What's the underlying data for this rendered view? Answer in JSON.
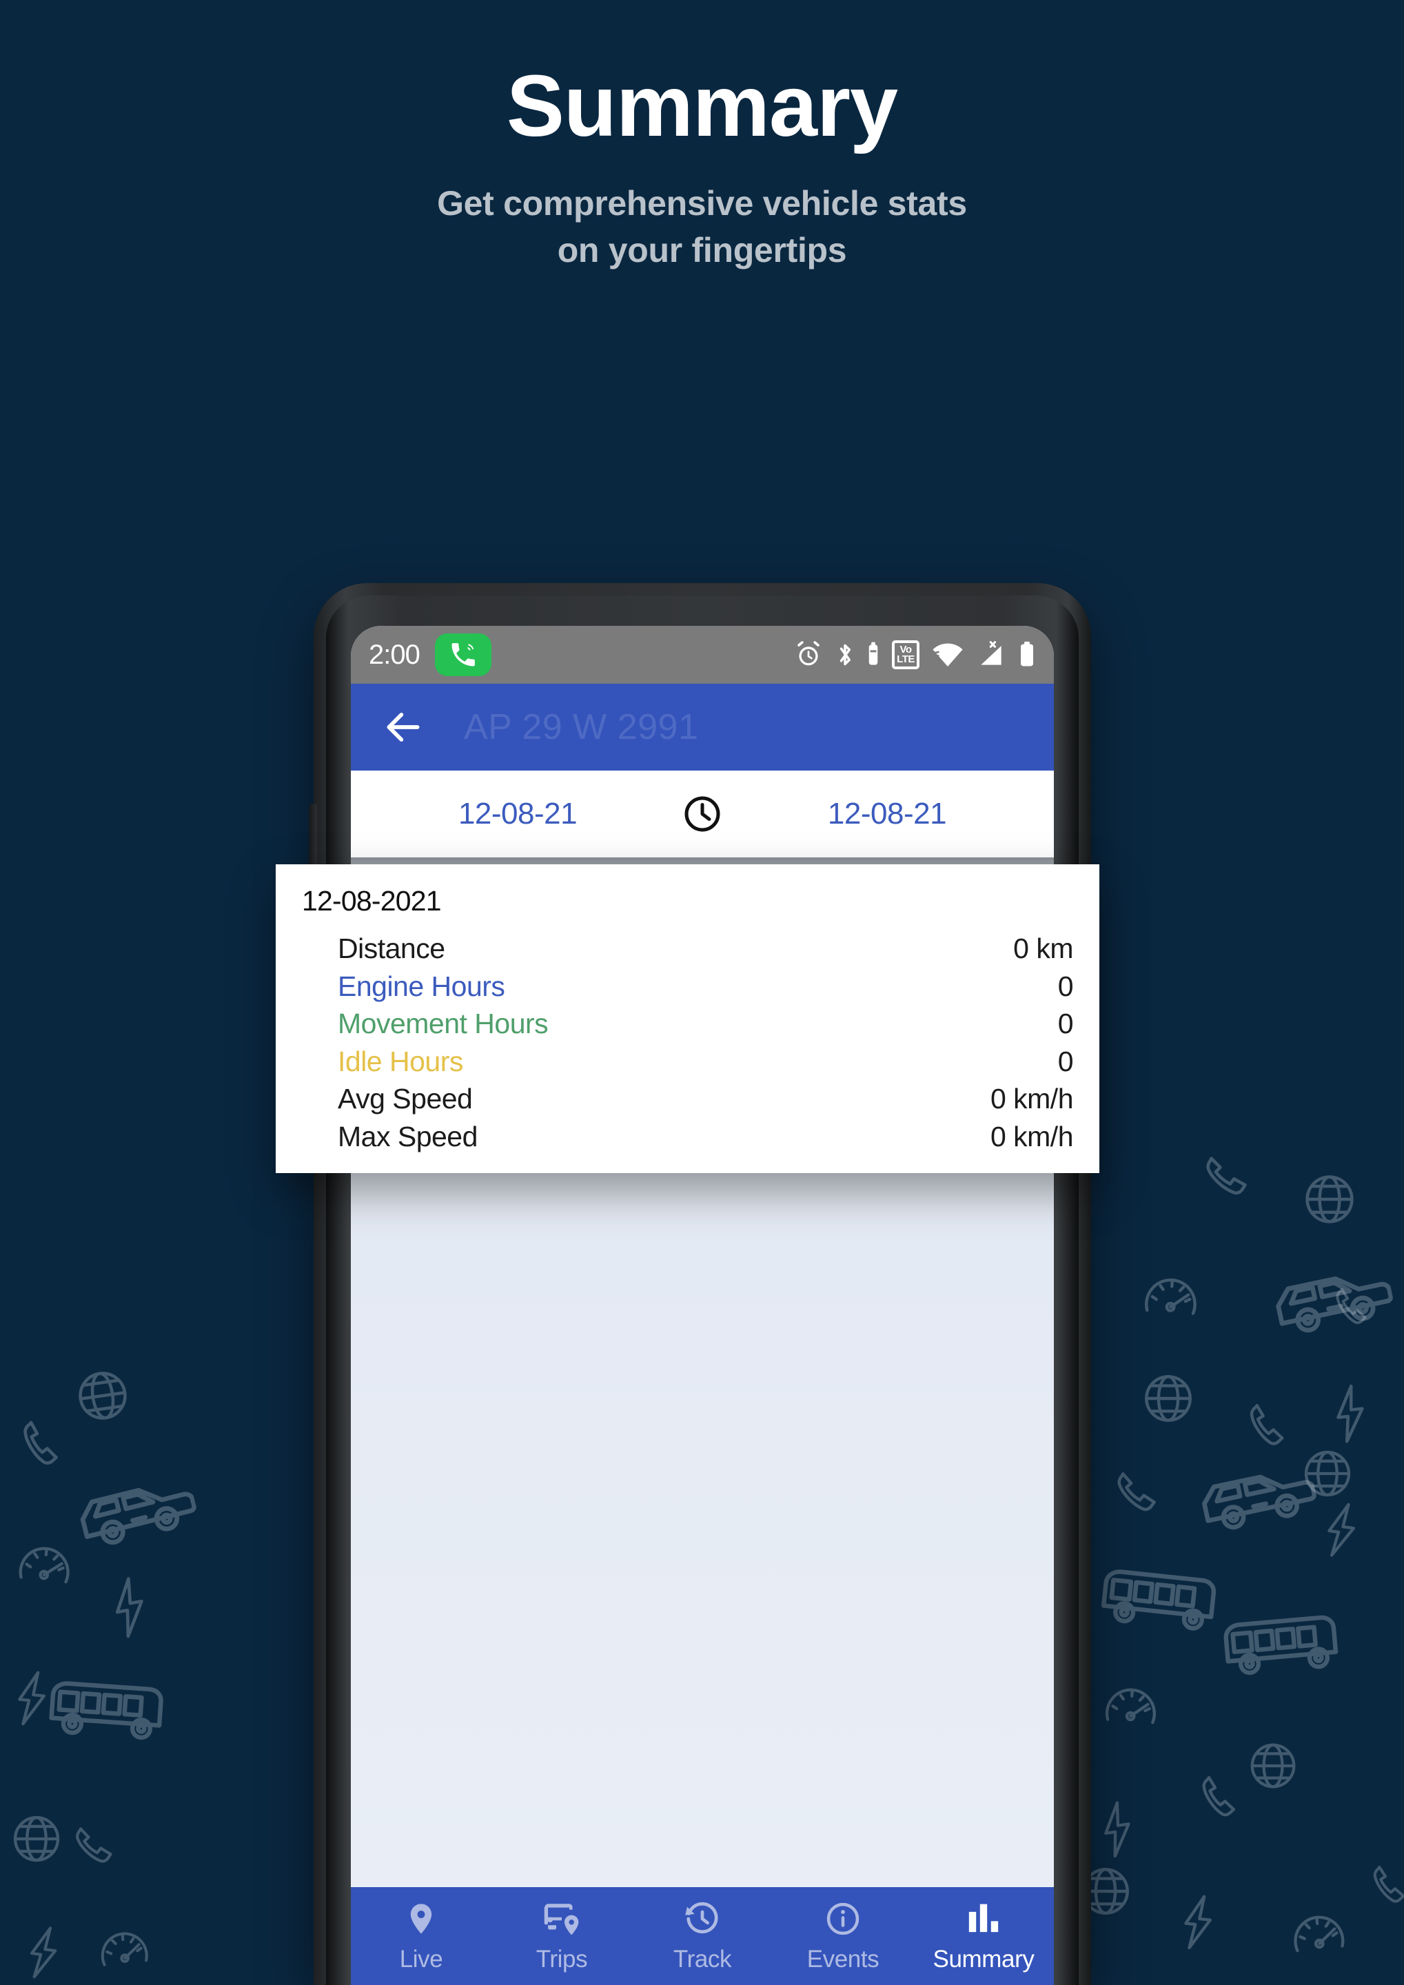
{
  "hero": {
    "title": "Summary",
    "subtitle": "Get comprehensive vehicle stats\non your fingertips"
  },
  "colors": {
    "background": "#0a2740",
    "app_bar_blue": "#3454bb",
    "status_bar_grey": "#7b7b7b",
    "call_badge_green": "#25c152",
    "screen_body": "#e9eef6",
    "accent_blue": "#3b5bbd",
    "accent_green": "#4f9f6b",
    "accent_yellow": "#e5c148"
  },
  "phone": {
    "status_bar": {
      "time": "2:00",
      "call_icon": "phone-call-icon",
      "icons": [
        "alarm-icon",
        "bluetooth-icon",
        "battery-small-icon",
        "volte-icon",
        "wifi-icon",
        "cellular-signal-x-icon",
        "battery-icon"
      ],
      "volte_top": "Vo",
      "volte_bottom": "LTE"
    },
    "app_bar": {
      "back_icon": "back-arrow-icon",
      "title": "AP 29 W 2991"
    },
    "date_row": {
      "start_date": "12-08-21",
      "clock_icon": "clock-icon",
      "end_date": "12-08-21"
    },
    "bottom_nav": {
      "items": [
        {
          "label": "Live",
          "icon": "map-pin-icon",
          "active": false
        },
        {
          "label": "Trips",
          "icon": "bus-location-icon",
          "active": false
        },
        {
          "label": "Track",
          "icon": "history-clock-icon",
          "active": false
        },
        {
          "label": "Events",
          "icon": "info-circle-icon",
          "active": false
        },
        {
          "label": "Summary",
          "icon": "bar-chart-icon",
          "active": true
        }
      ]
    }
  },
  "summary_card": {
    "date": "12-08-2021",
    "rows": [
      {
        "label": "Distance",
        "value": "0 km",
        "color": "default"
      },
      {
        "label": "Engine Hours",
        "value": "0",
        "color": "blue"
      },
      {
        "label": "Movement Hours",
        "value": "0",
        "color": "green"
      },
      {
        "label": "Idle Hours",
        "value": "0",
        "color": "yellow"
      },
      {
        "label": "Avg Speed",
        "value": "0 km/h",
        "color": "default"
      },
      {
        "label": "Max Speed",
        "value": "0 km/h",
        "color": "default"
      }
    ]
  },
  "background_pattern": {
    "icons": [
      "phone-outline-icon",
      "globe-outline-icon",
      "speedometer-outline-icon",
      "car-outline-icon",
      "bus-outline-icon",
      "lightning-outline-icon"
    ]
  }
}
